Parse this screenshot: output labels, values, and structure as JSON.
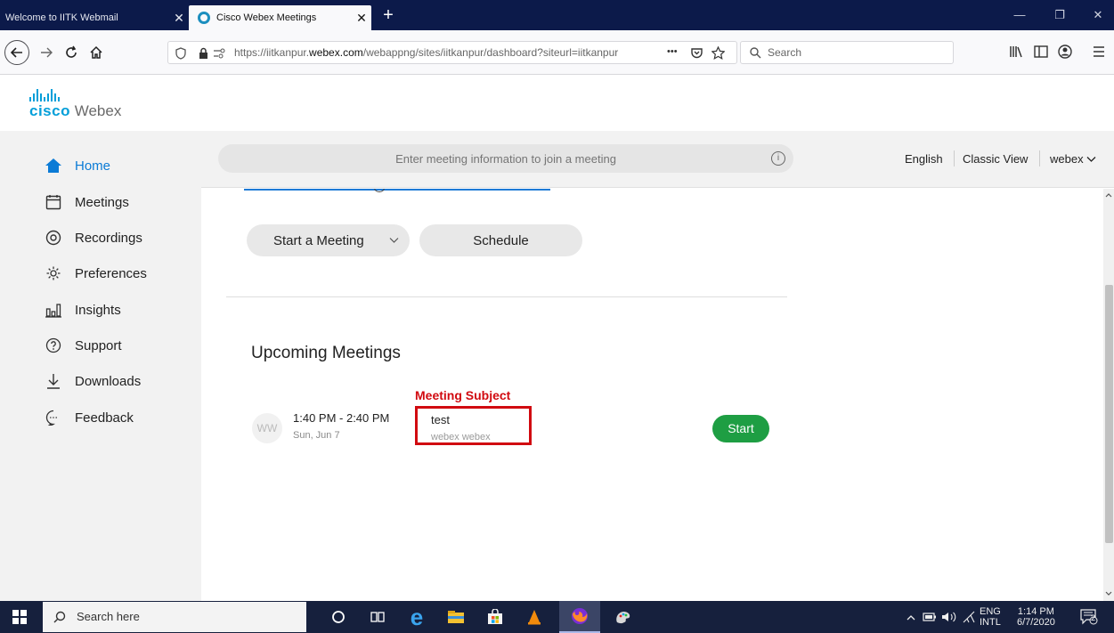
{
  "browser": {
    "tabs": [
      {
        "label": "Welcome to IITK Webmail",
        "active": false
      },
      {
        "label": "Cisco Webex Meetings",
        "active": true
      }
    ],
    "url": {
      "prefix": "https://iitkanpur.",
      "domain": "webex.com",
      "path": "/webappng/sites/iitkanpur/dashboard?siteurl=iitkanpur"
    },
    "search_placeholder": "Search",
    "more_label": "•••"
  },
  "logo": {
    "cisco": "cisco",
    "webex": "Webex"
  },
  "sidebar": {
    "items": [
      {
        "label": "Home",
        "icon": "home-icon",
        "active": true
      },
      {
        "label": "Meetings",
        "icon": "calendar-icon",
        "active": false
      },
      {
        "label": "Recordings",
        "icon": "record-icon",
        "active": false
      },
      {
        "label": "Preferences",
        "icon": "gear-icon",
        "active": false
      },
      {
        "label": "Insights",
        "icon": "insights-icon",
        "active": false
      },
      {
        "label": "Support",
        "icon": "help-icon",
        "active": false
      },
      {
        "label": "Downloads",
        "icon": "download-icon",
        "active": false
      },
      {
        "label": "Feedback",
        "icon": "feedback-icon",
        "active": false
      }
    ]
  },
  "topbar": {
    "join_placeholder": "Enter meeting information to join a meeting",
    "language": "English",
    "classic_view": "Classic View",
    "user": "webex"
  },
  "main": {
    "start_meeting": "Start a Meeting",
    "schedule": "Schedule",
    "section_title": "Upcoming Meetings",
    "annotation": "Meeting Subject",
    "meeting": {
      "avatar": "WW",
      "time": "1:40 PM - 2:40 PM",
      "date": "Sun, Jun 7",
      "subject": "test",
      "host": "webex webex",
      "start_label": "Start"
    }
  },
  "taskbar": {
    "search_placeholder": "Search here",
    "lang_top": "ENG",
    "lang_bottom": "INTL",
    "time": "1:14 PM",
    "date": "6/7/2020",
    "notification_count": "2"
  },
  "colors": {
    "accent": "#049fd9",
    "active": "#0b7bd6",
    "start": "#1e9e43",
    "annotation": "#d10a10"
  }
}
